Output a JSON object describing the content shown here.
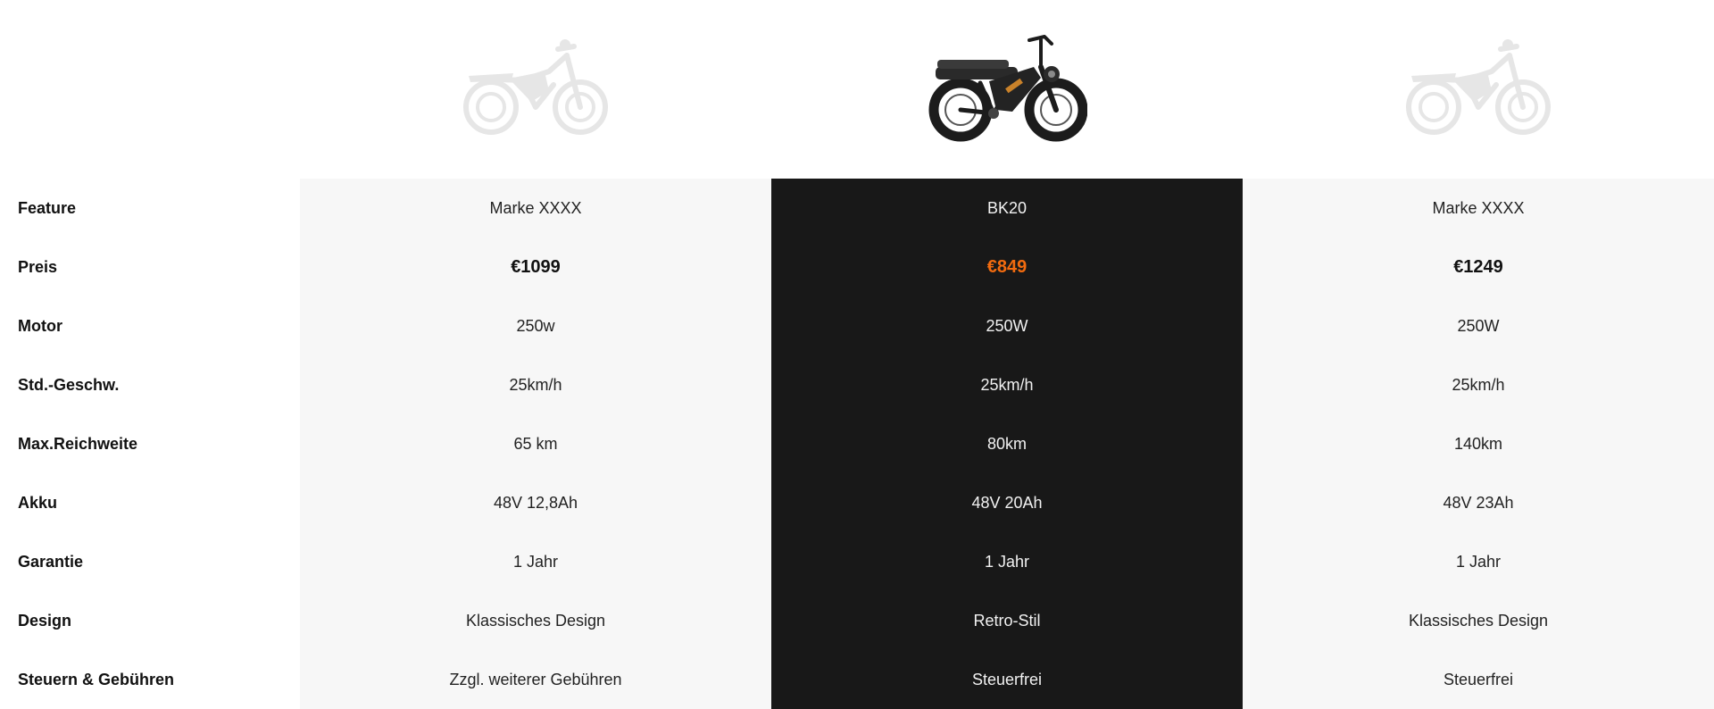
{
  "columns": {
    "competitor_left": {
      "image": "ghost-dirt-bike-icon"
    },
    "featured": {
      "image": "bk20-fat-tire-ebike-icon"
    },
    "competitor_right": {
      "image": "ghost-dirt-bike-icon"
    }
  },
  "rows": [
    {
      "label": "Feature",
      "v1": "Marke XXXX",
      "v2": "BK20",
      "v3": "Marke XXXX"
    },
    {
      "label": "Preis",
      "v1": "€1099",
      "v2": "€849",
      "v3": "€1249"
    },
    {
      "label": "Motor",
      "v1": "250w",
      "v2": "250W",
      "v3": "250W"
    },
    {
      "label": "Std.-Geschw.",
      "v1": "25km/h",
      "v2": "25km/h",
      "v3": "25km/h"
    },
    {
      "label": "Max.Reichweite",
      "v1": "65 km",
      "v2": "80km",
      "v3": "140km"
    },
    {
      "label": "Akku",
      "v1": "48V 12,8Ah",
      "v2": "48V 20Ah",
      "v3": "48V 23Ah"
    },
    {
      "label": "Garantie",
      "v1": "1 Jahr",
      "v2": "1 Jahr",
      "v3": "1 Jahr"
    },
    {
      "label": "Design",
      "v1": "Klassisches Design",
      "v2": "Retro-Stil",
      "v3": "Klassisches Design"
    },
    {
      "label": "Steuern & Gebühren",
      "v1": "Zzgl. weiterer Gebühren",
      "v2": "Steuerfrei",
      "v3": "Steuerfrei"
    }
  ],
  "colors": {
    "featured_bg": "#181818",
    "side_bg": "#f7f7f7",
    "price_accent": "#f26b0f"
  }
}
